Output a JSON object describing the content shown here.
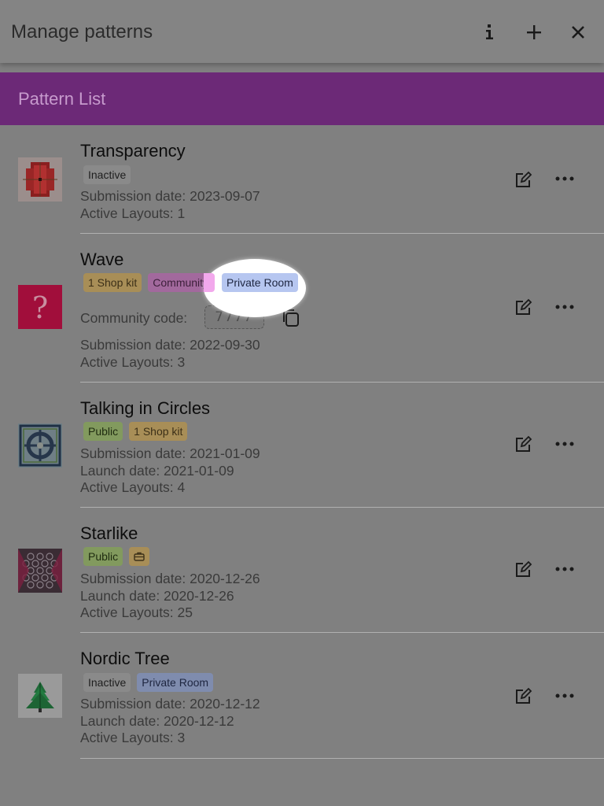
{
  "app_bar": {
    "title": "Manage patterns",
    "info_icon": "info-icon",
    "add_icon": "plus-icon",
    "close_icon": "close-icon"
  },
  "section": {
    "title": "Pattern List"
  },
  "patterns": [
    {
      "title": "Transparency",
      "thumbnail_icon": "transparency-thumbnail",
      "tags": [
        "Inactive"
      ],
      "submission": "Submission date: 2023-09-07",
      "active_layouts": "Active Layouts: 1"
    },
    {
      "title": "Wave",
      "thumbnail_icon": "question-mark-thumbnail",
      "thumbnail_glyph": "?",
      "tags": [
        "1 Shop kit",
        "Community",
        "Private Room"
      ],
      "community_code_label": "Community code:",
      "community_code_value": "7777",
      "submission": "Submission date: 2022-09-30",
      "active_layouts": "Active Layouts: 3"
    },
    {
      "title": "Talking in Circles",
      "thumbnail_icon": "circles-thumbnail",
      "tags": [
        "Public",
        "1 Shop kit"
      ],
      "submission": "Submission date: 2021-01-09",
      "launch": "Launch date: 2021-01-09",
      "active_layouts": "Active Layouts: 4"
    },
    {
      "title": "Starlike",
      "thumbnail_icon": "starlike-thumbnail",
      "tags": [
        "Public"
      ],
      "tag_icon": "briefcase-icon",
      "submission": "Submission date: 2020-12-26",
      "launch": "Launch date: 2020-12-26",
      "active_layouts": "Active Layouts: 25"
    },
    {
      "title": "Nordic Tree",
      "thumbnail_icon": "tree-thumbnail",
      "tags": [
        "Inactive",
        "Private Room"
      ],
      "submission": "Submission date: 2020-12-12",
      "launch": "Launch date: 2020-12-12",
      "active_layouts": "Active Layouts: 3"
    }
  ],
  "colors": {
    "overlay_bg": "#808080",
    "header_purple": "#6c2977",
    "spotlight": "#ffffff"
  }
}
